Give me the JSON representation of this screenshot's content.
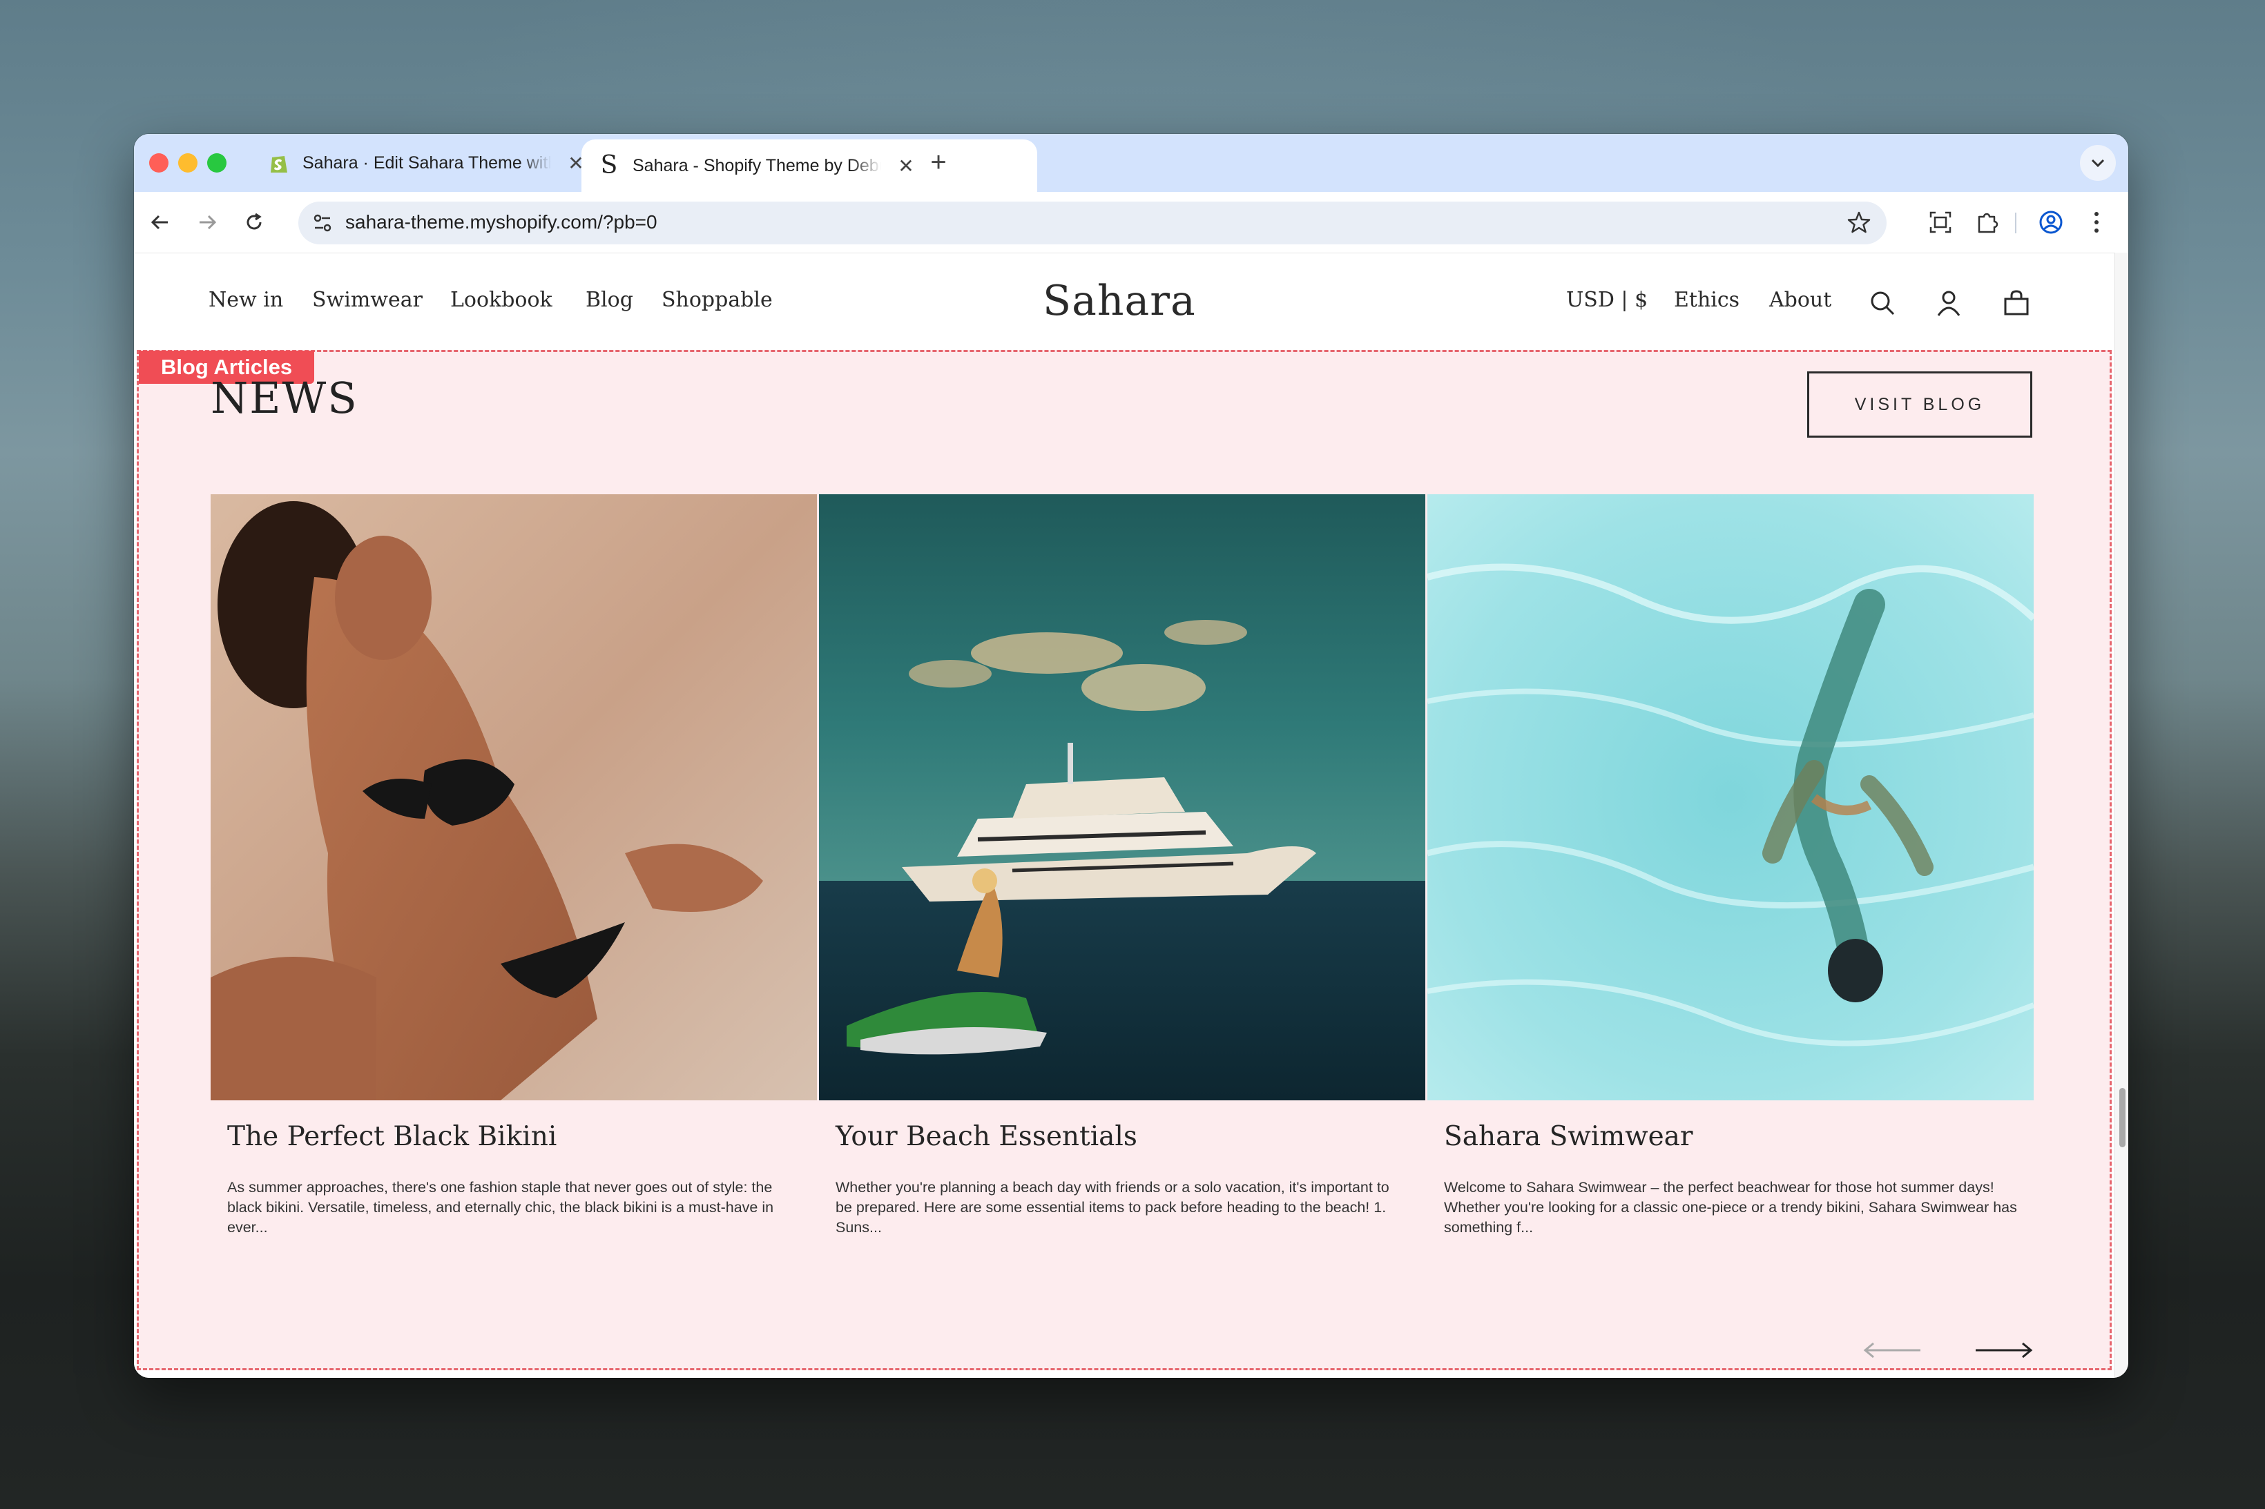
{
  "browser": {
    "tabs": [
      {
        "title": "Sahara · Edit Sahara Theme with",
        "close": "✕"
      },
      {
        "title": "Sahara - Shopify Theme by Debut",
        "close": "✕"
      }
    ],
    "new_tab": "+",
    "url": "sahara-theme.myshopify.com/?pb=0"
  },
  "site": {
    "nav_left": [
      "New in",
      "Swimwear",
      "Lookbook",
      "Blog",
      "Shoppable"
    ],
    "logo": "Sahara",
    "currency": "USD | $",
    "nav_right": [
      "Ethics",
      "About"
    ]
  },
  "section": {
    "tag": "Blog Articles",
    "title": "NEWS",
    "visit_button": "VISIT BLOG"
  },
  "articles": [
    {
      "title": "The Perfect Black Bikini",
      "excerpt": "As summer approaches, there's one fashion staple that never goes out of style: the black bikini. Versatile, timeless, and eternally chic, the black bikini is a must-have in ever..."
    },
    {
      "title": "Your Beach Essentials",
      "excerpt": "Whether you're planning a beach day with friends or a solo vacation, it's important to be prepared. Here are some essential items to pack before heading to the beach! 1. Suns..."
    },
    {
      "title": "Sahara Swimwear",
      "excerpt": "Welcome to Sahara Swimwear – the perfect beachwear for those hot summer days! Whether you're looking for a classic one-piece or a trendy bikini, Sahara Swimwear has something f..."
    }
  ],
  "icons": {
    "traffic_lights": [
      "close-window",
      "minimize-window",
      "maximize-window"
    ],
    "toolbar": [
      "back-icon",
      "forward-icon",
      "reload-icon",
      "site-info-icon",
      "star-icon",
      "screenshot-icon",
      "extensions-icon",
      "profile-icon",
      "more-icon"
    ],
    "header": [
      "search-icon",
      "account-icon",
      "cart-icon"
    ],
    "carousel": [
      "arrow-left-icon",
      "arrow-right-icon"
    ]
  },
  "colors": {
    "section_bg": "#fdecee",
    "tag_bg": "#f04d55",
    "tab_strip": "#d3e3fd"
  }
}
